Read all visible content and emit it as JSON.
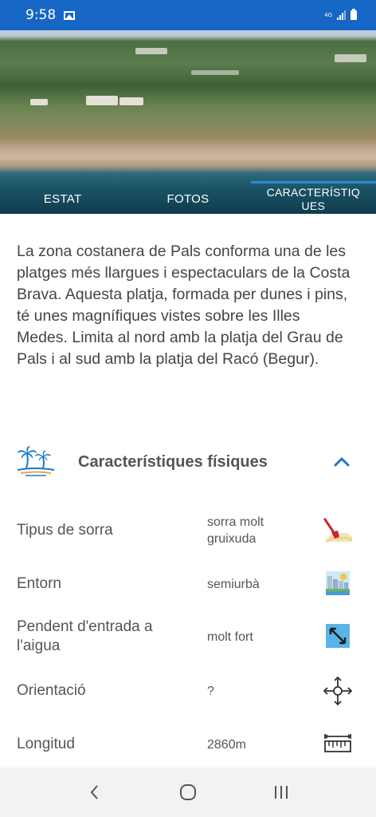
{
  "status_bar": {
    "time": "9:58",
    "network": "4G"
  },
  "tabs": [
    {
      "label": "ESTAT"
    },
    {
      "label": "FOTOS"
    },
    {
      "label": "CARACTERÍSTIQUES"
    }
  ],
  "active_tab_lines": [
    "CARACTERÍSTIQ",
    "UES"
  ],
  "description": "La zona costanera de Pals conforma una de les platges més llargues i espectaculars de la Costa Brava. Aquesta platja, formada per dunes i pins, té unes magnífiques vistes sobre les Illes Medes. Limita al nord amb la platja del Grau de Pals i al sud amb la platja del Racó (Begur).",
  "section": {
    "title": "Característiques físiques",
    "icon": "palm-beach-icon",
    "expanded": true
  },
  "rows": [
    {
      "label": "Tipus de sorra",
      "value": "sorra molt gruixuda",
      "icon": "sand-shovel-icon"
    },
    {
      "label": "Entorn",
      "value": "semiurbà",
      "icon": "city-skyline-icon"
    },
    {
      "label": "Pendent d'entrada a l'aigua",
      "value": "molt fort",
      "icon": "slope-arrow-icon"
    },
    {
      "label": "Orientació",
      "value": "?",
      "icon": "compass-move-icon"
    },
    {
      "label": "Longitud",
      "value": "2860m",
      "icon": "ruler-icon"
    }
  ],
  "colors": {
    "status_bar": "#1666c5",
    "tab_indicator": "#2c8ad9",
    "chevron": "#1b78c9"
  }
}
